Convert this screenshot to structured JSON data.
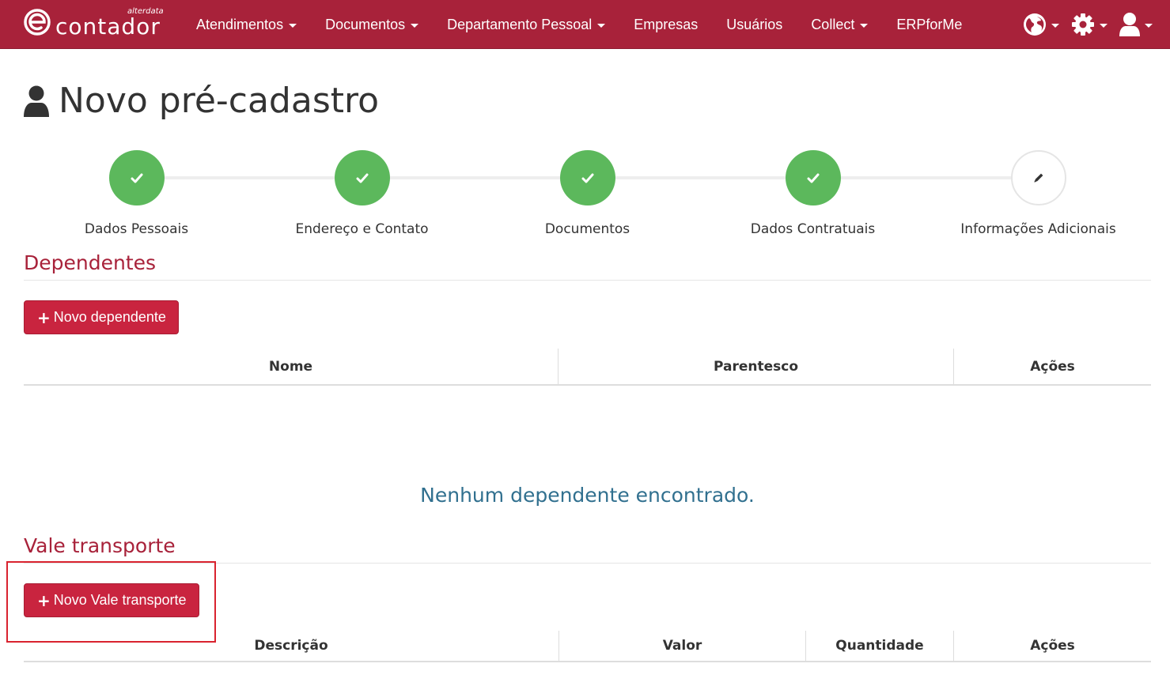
{
  "brand": {
    "name": "contador",
    "superscript": "alterdata",
    "logo_letter": "e"
  },
  "nav": {
    "items": [
      {
        "label": "Atendimentos",
        "dropdown": true
      },
      {
        "label": "Documentos",
        "dropdown": true
      },
      {
        "label": "Departamento Pessoal",
        "dropdown": true
      },
      {
        "label": "Empresas",
        "dropdown": false
      },
      {
        "label": "Usuários",
        "dropdown": false
      },
      {
        "label": "Collect",
        "dropdown": true
      },
      {
        "label": "ERPforMe",
        "dropdown": false
      }
    ],
    "right_icons": [
      "globe-icon",
      "gear-icon",
      "user-icon"
    ]
  },
  "page": {
    "title": "Novo pré-cadastro",
    "title_icon": "user-icon"
  },
  "steps": [
    {
      "label": "Dados Pessoais",
      "status": "done",
      "icon": "check-icon"
    },
    {
      "label": "Endereço e Contato",
      "status": "done",
      "icon": "check-icon"
    },
    {
      "label": "Documentos",
      "status": "done",
      "icon": "check-icon"
    },
    {
      "label": "Dados Contratuais",
      "status": "done",
      "icon": "check-icon"
    },
    {
      "label": "Informações Adicionais",
      "status": "active",
      "icon": "pencil-icon"
    }
  ],
  "dependentes": {
    "title": "Dependentes",
    "new_button": "Novo dependente",
    "columns": [
      "Nome",
      "Parentesco",
      "Ações"
    ],
    "empty_message": "Nenhum dependente encontrado."
  },
  "vale_transporte": {
    "title": "Vale transporte",
    "new_button": "Novo Vale transporte",
    "columns": [
      "Descrição",
      "Valor",
      "Quantidade",
      "Ações"
    ]
  },
  "colors": {
    "brand": "#a8223a",
    "primary_button": "#c9243f",
    "step_done": "#5cb85c",
    "empty_text": "#31708f",
    "highlight": "#d9232f"
  }
}
